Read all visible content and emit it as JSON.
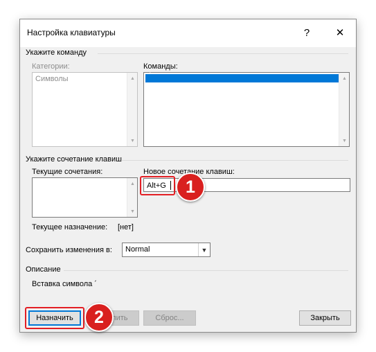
{
  "dialog": {
    "title": "Настройка клавиатуры",
    "help_glyph": "?",
    "close_glyph": "✕"
  },
  "command_section": {
    "label": "Укажите команду",
    "categories_label": "Категории:",
    "categories_items": [
      "Символы"
    ],
    "commands_label": "Команды:",
    "commands_selected_item": "´"
  },
  "shortcut_section": {
    "label": "Укажите сочетание клавиш",
    "current_label": "Текущие сочетания:",
    "new_label": "Новое сочетание клавиш:",
    "new_value": "Alt+G",
    "assignment_label": "Текущее назначение:",
    "assignment_value": "[нет]"
  },
  "save_in": {
    "label": "Сохранить изменения в:",
    "value": "Normal"
  },
  "description": {
    "label": "Описание",
    "text": "Вставка символа ´"
  },
  "buttons": {
    "assign": "Назначить",
    "remove": "Удалить",
    "reset": "Сброс...",
    "close": "Закрыть"
  },
  "annotations": {
    "step1": "1",
    "step2": "2"
  },
  "colors": {
    "selection": "#0078d7",
    "highlight_red": "#e31e24",
    "badge_red": "#d9201f"
  }
}
